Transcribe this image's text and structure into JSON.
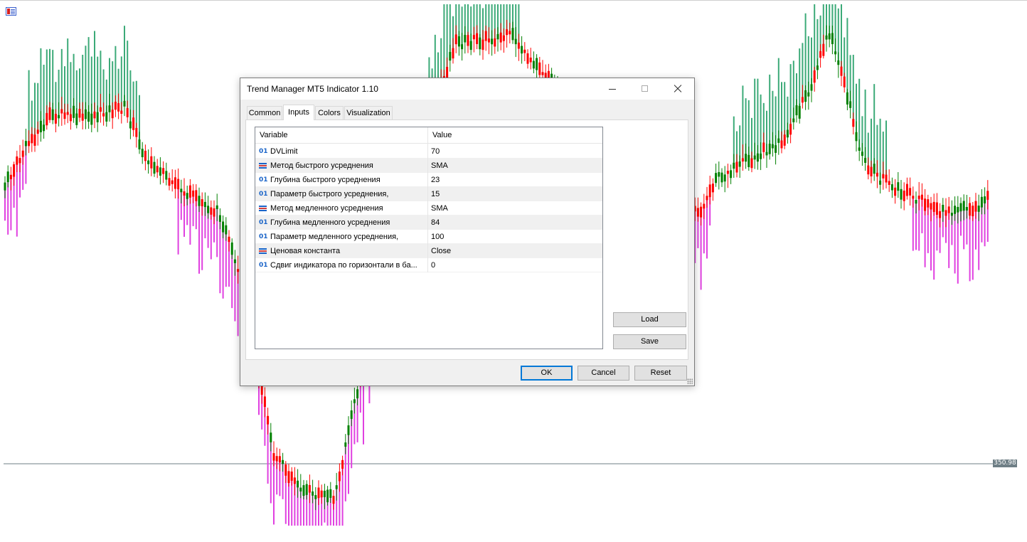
{
  "chart": {
    "price_label": "350.98",
    "colors": {
      "bull_candle": "#008000",
      "bear_candle": "#ff0000",
      "bar_up": "#3caa78",
      "bar_down": "#e040e0",
      "price_line": "#6f7f86"
    }
  },
  "dialog": {
    "title": "Trend Manager MT5 Indicator 1.10",
    "tabs": [
      {
        "label": "Common"
      },
      {
        "label": "Inputs"
      },
      {
        "label": "Colors"
      },
      {
        "label": "Visualization"
      }
    ],
    "active_tab": "Inputs",
    "grid": {
      "headers": {
        "variable": "Variable",
        "value": "Value"
      },
      "rows": [
        {
          "icon": "int-icon",
          "icon_text": "01",
          "name": "DVLimit",
          "value": "70"
        },
        {
          "icon": "enum-icon",
          "icon_text": "",
          "name": "Метод быстрого усреднения",
          "value": "SMA"
        },
        {
          "icon": "int-icon",
          "icon_text": "01",
          "name": "Глубина быстрого усреднения",
          "value": "23"
        },
        {
          "icon": "int-icon",
          "icon_text": "01",
          "name": "Параметр быстрого усреднения,",
          "value": "15"
        },
        {
          "icon": "enum-icon",
          "icon_text": "",
          "name": "Метод медленного усреднения",
          "value": "SMA"
        },
        {
          "icon": "int-icon",
          "icon_text": "01",
          "name": "Глубина медленного усреднения",
          "value": "84"
        },
        {
          "icon": "int-icon",
          "icon_text": "01",
          "name": "Параметр медленного усреднения,",
          "value": "100"
        },
        {
          "icon": "enum-icon",
          "icon_text": "",
          "name": "Ценовая константа",
          "value": "Close"
        },
        {
          "icon": "int-icon",
          "icon_text": "01",
          "name": "Сдвиг индикатора по горизонтали в ба...",
          "value": "0"
        }
      ]
    },
    "buttons": {
      "load": "Load",
      "save": "Save",
      "ok": "OK",
      "cancel": "Cancel",
      "reset": "Reset"
    }
  }
}
